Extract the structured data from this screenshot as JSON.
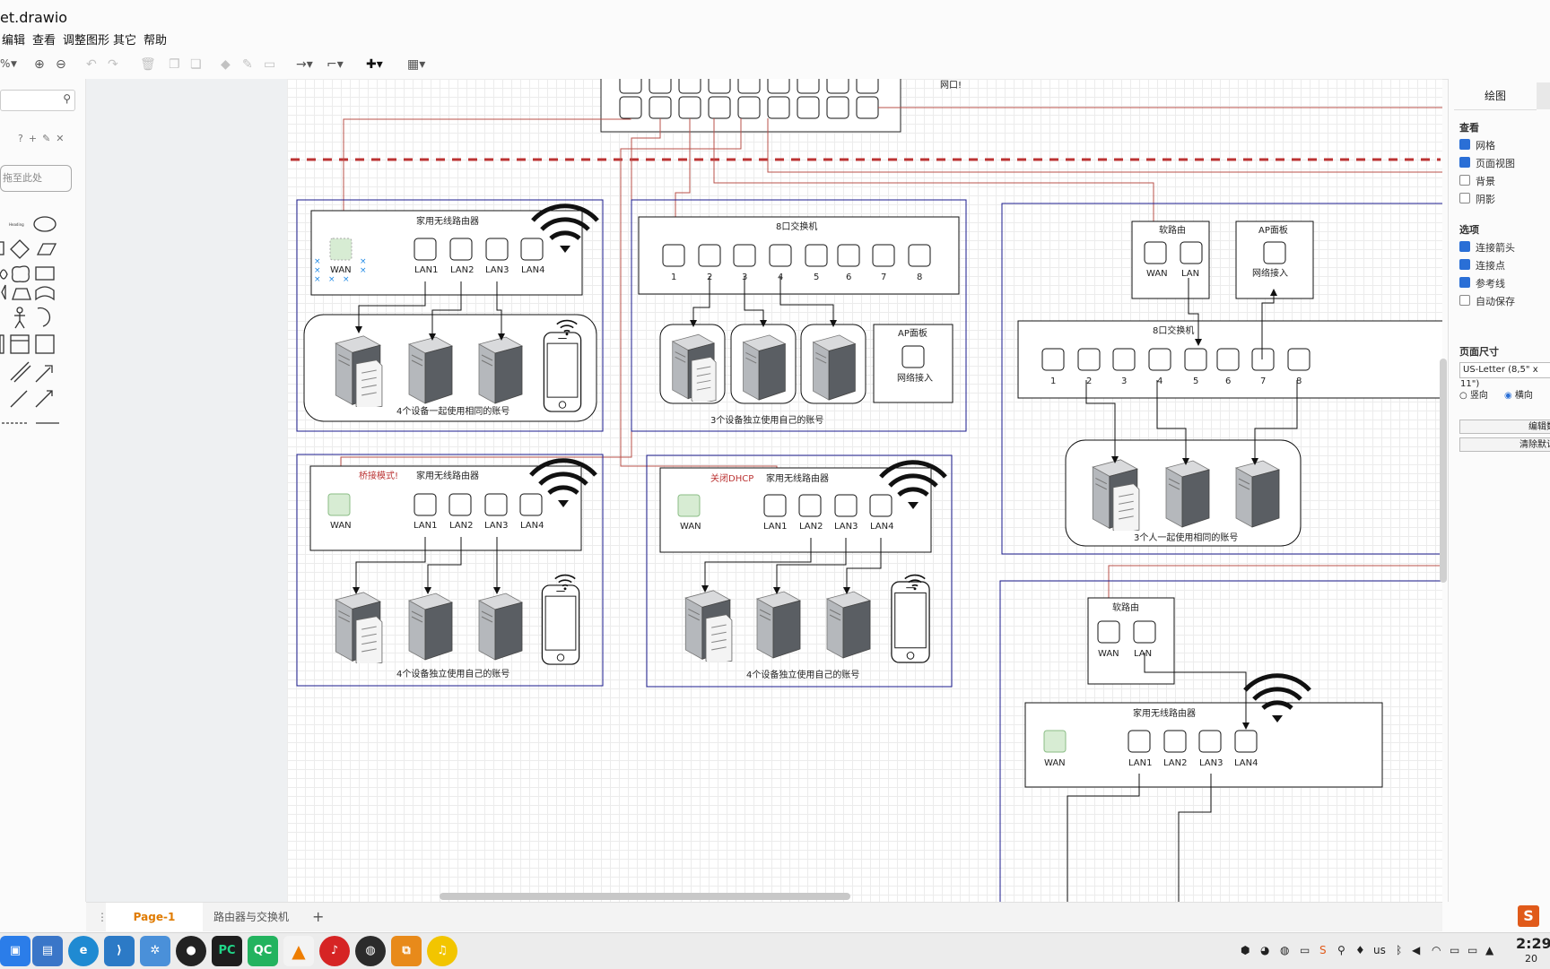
{
  "window": {
    "title": "et.drawio"
  },
  "menu": [
    "编辑",
    "查看",
    "调整图形",
    "其它",
    "帮助"
  ],
  "toolbar": {
    "zoom": "%"
  },
  "sidebar": {
    "drop_text": "拖至此处"
  },
  "diagram": {
    "top_note": "网口!",
    "router_title": "家用无线路由器",
    "switch_title": "8口交换机",
    "soft_router": "软路由",
    "ap_panel": "AP面板",
    "net_access": "网络接入",
    "bridge_mode": "桥接模式!",
    "dhcp_off": "关闭DHCP",
    "wan": "WAN",
    "lan": "LAN",
    "lan_ports": [
      "LAN1",
      "LAN2",
      "LAN3",
      "LAN4"
    ],
    "switch_ports": [
      "1",
      "2",
      "3",
      "4",
      "5",
      "6",
      "7",
      "8"
    ],
    "cap1": "4个设备一起使用相同的账号",
    "cap2": "3个设备独立使用自己的账号",
    "cap3": "4个设备独立使用自己的账号",
    "cap4": "4个设备独立使用自己的账号",
    "cap5": "3个人一起使用相同的账号"
  },
  "format_panel": {
    "tab": "绘图",
    "view_header": "查看",
    "view_opts": [
      {
        "label": "网格",
        "checked": true
      },
      {
        "label": "页面视图",
        "checked": true
      },
      {
        "label": "背景",
        "checked": false
      },
      {
        "label": "阴影",
        "checked": false
      }
    ],
    "options_header": "选项",
    "options": [
      {
        "label": "连接箭头",
        "checked": true
      },
      {
        "label": "连接点",
        "checked": true
      },
      {
        "label": "参考线",
        "checked": true
      },
      {
        "label": "自动保存",
        "checked": false
      }
    ],
    "page_size_header": "页面尺寸",
    "page_size": "US-Letter (8,5\" x 11\")",
    "portrait": "竖向",
    "landscape": "横向",
    "edit_data": "编辑数",
    "clear_default": "清除默认"
  },
  "pages": [
    "Page-1",
    "路由器与交换机"
  ],
  "taskbar": {
    "apps": [
      "PC",
      "QC"
    ],
    "time": "2:29",
    "year": "20",
    "lang": "us"
  },
  "colors": {
    "accent": "#e07b00",
    "link_red": "#b8504a",
    "box_blue": "#1a1a8c",
    "wan_green": "#d7ecd3"
  }
}
